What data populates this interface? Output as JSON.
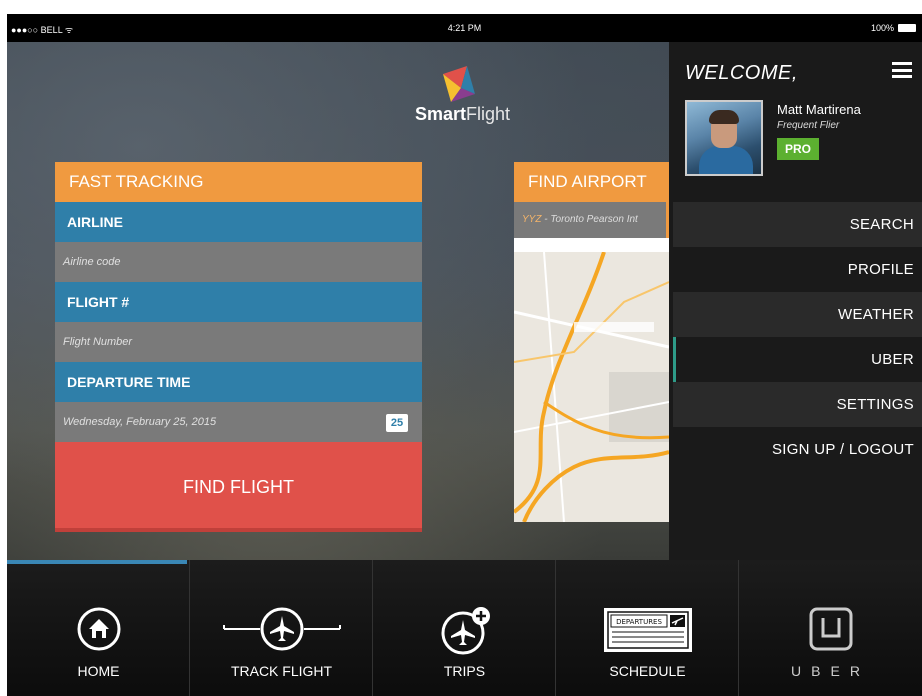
{
  "status_bar": {
    "carrier": "●●●○○ BELL ᯤ",
    "time": "4:21 PM",
    "battery": "100%"
  },
  "logo": {
    "brand_bold": "Smart",
    "brand_light": "Flight"
  },
  "fast_tracking": {
    "title": "FAST TRACKING",
    "airline_label": "AIRLINE",
    "airline_placeholder": "Airline code",
    "flight_label": "FLIGHT #",
    "flight_placeholder": "Flight Number",
    "departure_label": "DEPARTURE TIME",
    "departure_value": "Wednesday, February 25, 2015",
    "calendar_day": "25",
    "find_button": "FIND FLIGHT"
  },
  "find_airport": {
    "title": "FIND AIRPORT",
    "result_code": "YYZ",
    "result_name": " - Toronto Pearson Int"
  },
  "drawer": {
    "welcome": "WELCOME,",
    "user_name": "Matt Martirena",
    "user_tier": "Frequent Flier",
    "badge": "PRO",
    "nav": [
      "SEARCH",
      "PROFILE",
      "WEATHER",
      "UBER",
      "SETTINGS",
      "SIGN UP / LOGOUT"
    ]
  },
  "tabs": [
    {
      "label": "HOME",
      "icon": "home-icon"
    },
    {
      "label": "TRACK FLIGHT",
      "icon": "plane-track-icon"
    },
    {
      "label": "TRIPS",
      "icon": "plane-add-icon"
    },
    {
      "label": "SCHEDULE",
      "icon": "departures-board-icon",
      "board_text": "DEPARTURES"
    },
    {
      "label": "UBER",
      "icon": "uber-logo-icon"
    }
  ],
  "colors": {
    "accent_orange": "#f09a40",
    "field_blue": "#2f7fa9",
    "button_red": "#e0514a",
    "pro_green": "#5cb030",
    "uber_teal": "#2e9b88"
  }
}
